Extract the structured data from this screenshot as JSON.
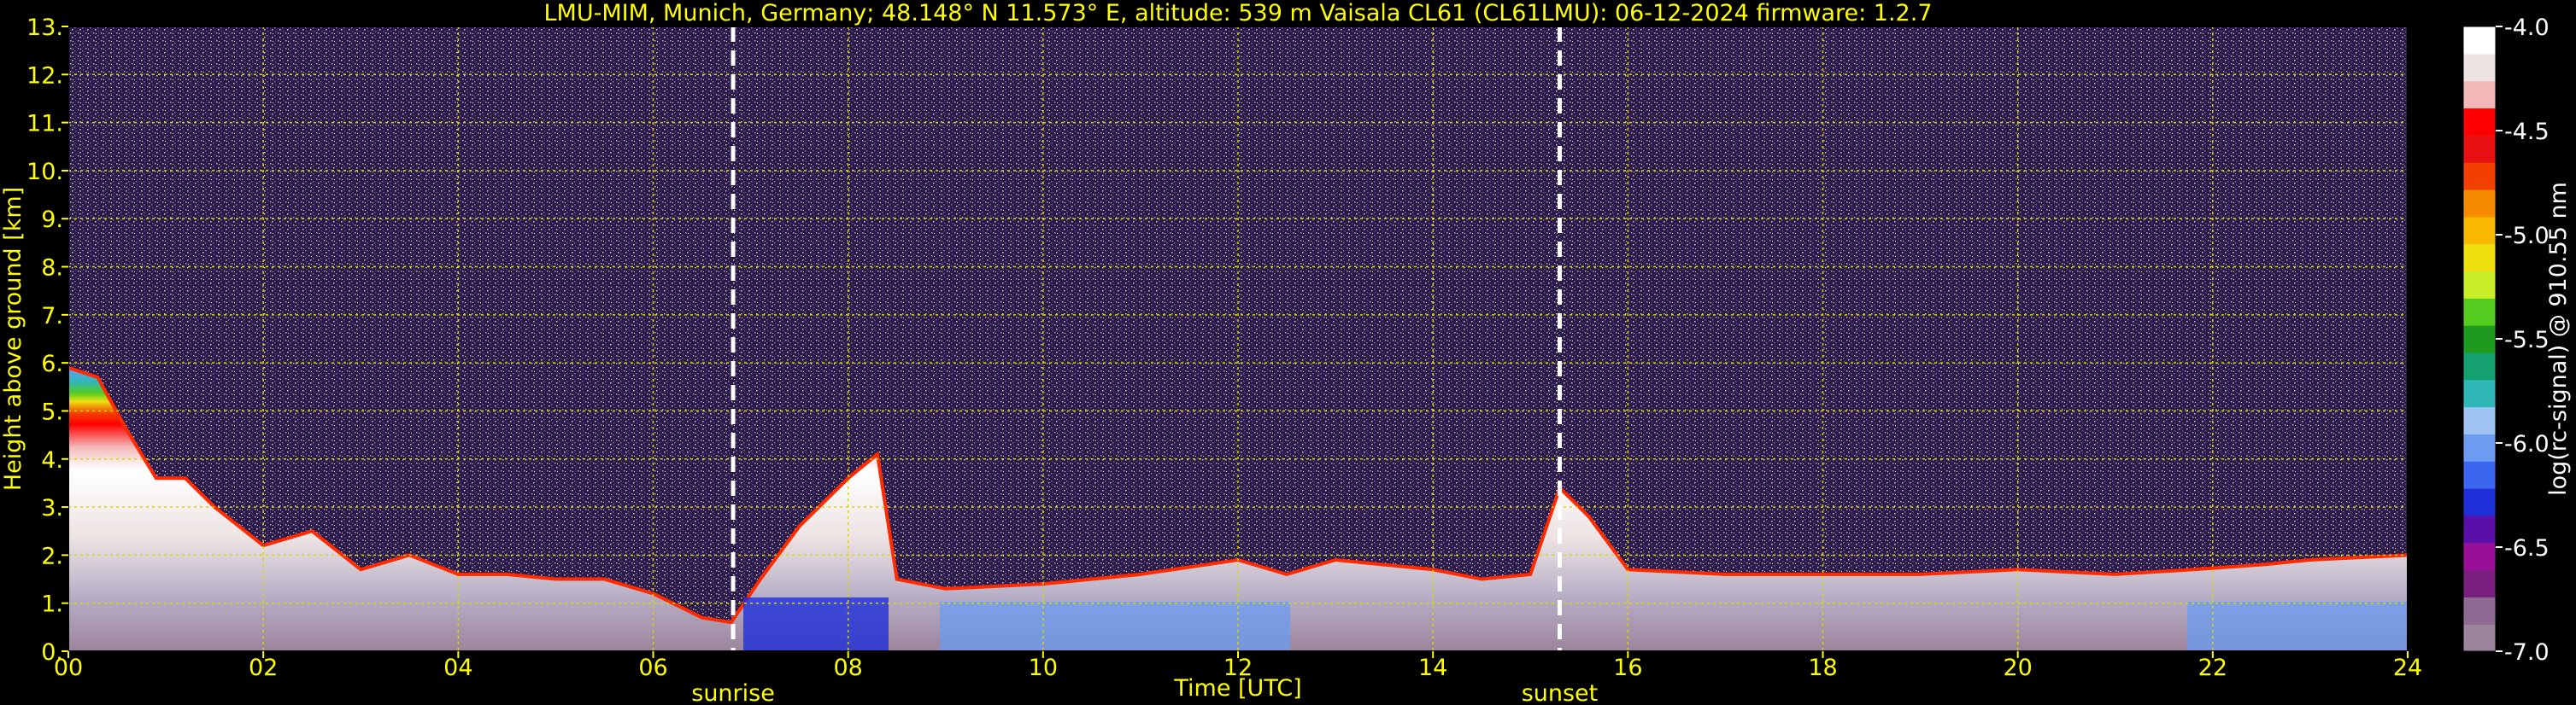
{
  "chart_data": {
    "type": "heatmap",
    "title": "LMU-MIM, Munich, Germany; 48.148° N 11.573° E, altitude: 539 m    Vaisala CL61 (CL61LMU): 06-12-2024    firmware: 1.2.7",
    "xlabel": "Time [UTC]",
    "ylabel": "Height above ground [km]",
    "xlim": [
      0,
      24
    ],
    "ylim": [
      0,
      13
    ],
    "x_ticks": [
      "00",
      "02",
      "04",
      "06",
      "08",
      "10",
      "12",
      "14",
      "16",
      "18",
      "20",
      "22",
      "24"
    ],
    "y_ticks": [
      "0.",
      "1.",
      "2.",
      "3.",
      "4.",
      "5.",
      "6.",
      "7.",
      "8.",
      "9.",
      "10.",
      "11.",
      "12.",
      "13."
    ],
    "grid": true,
    "events": [
      {
        "label": "sunrise",
        "x": 6.82
      },
      {
        "label": "sunset",
        "x": 15.3
      }
    ],
    "colorbar": {
      "label": "log(rc-signal) @ 910.55 nm",
      "range": [
        -7.0,
        -4.0
      ],
      "ticks": [
        "-4.0",
        "-4.5",
        "-5.0",
        "-5.5",
        "-6.0",
        "-6.5",
        "-7.0"
      ],
      "tick_values": [
        -4.0,
        -4.5,
        -5.0,
        -5.5,
        -6.0,
        -6.5,
        -7.0
      ],
      "colors": [
        "#9c849c",
        "#8e6a94",
        "#7a1f7e",
        "#9a0f9a",
        "#5a10a8",
        "#1f2fd8",
        "#3a66f0",
        "#6b9cf2",
        "#9fc4f4",
        "#30b8b8",
        "#15a070",
        "#1e9a1e",
        "#55cc20",
        "#c8ee28",
        "#f0e010",
        "#f8b800",
        "#f58a00",
        "#f24000",
        "#e81010",
        "#ff0000",
        "#f3b9b9",
        "#ede3e3",
        "#ffffff"
      ]
    },
    "boundary_layer_top_km": [
      {
        "t": 0.0,
        "h": 5.9
      },
      {
        "t": 0.3,
        "h": 5.7
      },
      {
        "t": 0.6,
        "h": 4.6
      },
      {
        "t": 0.9,
        "h": 3.6
      },
      {
        "t": 1.2,
        "h": 3.6
      },
      {
        "t": 1.5,
        "h": 3.0
      },
      {
        "t": 2.0,
        "h": 2.2
      },
      {
        "t": 2.5,
        "h": 2.5
      },
      {
        "t": 3.0,
        "h": 1.7
      },
      {
        "t": 3.5,
        "h": 2.0
      },
      {
        "t": 4.0,
        "h": 1.6
      },
      {
        "t": 4.5,
        "h": 1.6
      },
      {
        "t": 5.0,
        "h": 1.5
      },
      {
        "t": 5.5,
        "h": 1.5
      },
      {
        "t": 6.0,
        "h": 1.2
      },
      {
        "t": 6.5,
        "h": 0.7
      },
      {
        "t": 6.8,
        "h": 0.6
      },
      {
        "t": 7.1,
        "h": 1.5
      },
      {
        "t": 7.5,
        "h": 2.6
      },
      {
        "t": 8.0,
        "h": 3.6
      },
      {
        "t": 8.3,
        "h": 4.1
      },
      {
        "t": 8.5,
        "h": 1.5
      },
      {
        "t": 9.0,
        "h": 1.3
      },
      {
        "t": 10.0,
        "h": 1.4
      },
      {
        "t": 11.0,
        "h": 1.6
      },
      {
        "t": 12.0,
        "h": 1.9
      },
      {
        "t": 12.5,
        "h": 1.6
      },
      {
        "t": 13.0,
        "h": 1.9
      },
      {
        "t": 13.5,
        "h": 1.8
      },
      {
        "t": 14.0,
        "h": 1.7
      },
      {
        "t": 14.5,
        "h": 1.5
      },
      {
        "t": 15.0,
        "h": 1.6
      },
      {
        "t": 15.3,
        "h": 3.4
      },
      {
        "t": 15.6,
        "h": 2.8
      },
      {
        "t": 16.0,
        "h": 1.7
      },
      {
        "t": 17.0,
        "h": 1.6
      },
      {
        "t": 18.0,
        "h": 1.6
      },
      {
        "t": 19.0,
        "h": 1.6
      },
      {
        "t": 20.0,
        "h": 1.7
      },
      {
        "t": 21.0,
        "h": 1.6
      },
      {
        "t": 21.8,
        "h": 1.7
      },
      {
        "t": 22.5,
        "h": 1.8
      },
      {
        "t": 23.0,
        "h": 1.9
      },
      {
        "t": 24.0,
        "h": 2.0
      }
    ]
  }
}
